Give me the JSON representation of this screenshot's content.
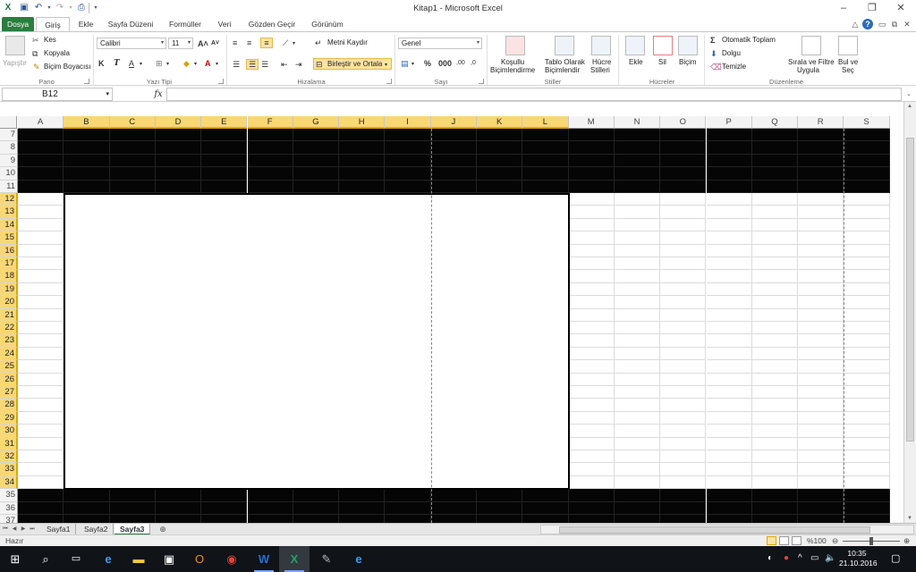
{
  "window": {
    "title": "Kitap1  -  Microsoft Excel",
    "controls": [
      "–",
      "❐",
      "✕"
    ]
  },
  "ribbon_tabs": [
    "Dosya",
    "Giriş",
    "Ekle",
    "Sayfa Düzeni",
    "Formüller",
    "Veri",
    "Gözden Geçir",
    "Görünüm"
  ],
  "active_tab": "Giriş",
  "clipboard": {
    "paste": "Yapıştır",
    "cut": "Kes",
    "copy": "Kopyala",
    "format_painter": "Biçim Boyacısı",
    "group": "Pano"
  },
  "font": {
    "name": "Calibri",
    "size": "11",
    "group": "Yazı Tipi"
  },
  "alignment": {
    "wrap": "Metni Kaydır",
    "merge": "Birleştir ve Ortala",
    "group": "Hizalama"
  },
  "number": {
    "format": "Genel",
    "group": "Sayı"
  },
  "styles": {
    "conditional": [
      "Koşullu",
      "Biçimlendirme"
    ],
    "table": [
      "Tablo Olarak",
      "Biçimlendir"
    ],
    "cell": [
      "Hücre",
      "Stilleri"
    ],
    "group": "Stiller"
  },
  "cells": {
    "insert": "Ekle",
    "delete": "Sil",
    "format": "Biçim",
    "group": "Hücreler"
  },
  "editing": {
    "autosum": "Otomatik Toplam",
    "fill": "Dolgu",
    "clear": "Temizle",
    "sort": [
      "Sırala ve Filtre",
      "Uygula"
    ],
    "find": [
      "Bul ve",
      "Seç"
    ],
    "group": "Düzenleme"
  },
  "formula_bar": {
    "name_box": "B12",
    "fx": "fx",
    "value": ""
  },
  "columns": [
    "A",
    "B",
    "C",
    "D",
    "E",
    "F",
    "G",
    "H",
    "I",
    "J",
    "K",
    "L",
    "M",
    "N",
    "O",
    "P",
    "Q",
    "R",
    "S"
  ],
  "selected_columns": [
    "B",
    "C",
    "D",
    "E",
    "F",
    "G",
    "H",
    "I",
    "J",
    "K",
    "L"
  ],
  "rows": [
    "7",
    "8",
    "9",
    "10",
    "11",
    "12",
    "13",
    "14",
    "15",
    "16",
    "17",
    "18",
    "19",
    "20",
    "21",
    "22",
    "23",
    "24",
    "25",
    "26",
    "27",
    "28",
    "29",
    "30",
    "31",
    "32",
    "33",
    "34",
    "35",
    "36",
    "37"
  ],
  "selected_rows": [
    "12",
    "13",
    "14",
    "15",
    "16",
    "17",
    "18",
    "19",
    "20",
    "21",
    "22",
    "23",
    "24",
    "25",
    "26",
    "27",
    "28",
    "29",
    "30",
    "31",
    "32",
    "33",
    "34"
  ],
  "merged_range": "B12:L34",
  "sheet_tabs": [
    "Sayfa1",
    "Sayfa2",
    "Sayfa3"
  ],
  "active_sheet": "Sayfa3",
  "status": {
    "ready": "Hazır",
    "zoom": "%100"
  },
  "taskbar": {
    "time": "10:35",
    "date": "21.10.2016"
  },
  "colors": {
    "file_tab": "#2a7d3e",
    "selected_header": "#f8d776",
    "black_fill": "#050505",
    "taskbar": "#101418"
  }
}
